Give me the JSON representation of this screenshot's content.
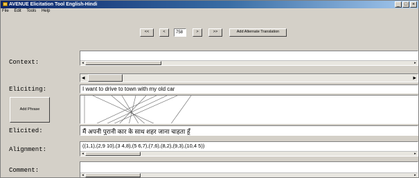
{
  "window": {
    "title": "AVENUE Elicitation Tool English-Hindi",
    "buttons": [
      "_",
      "□",
      "×"
    ]
  },
  "menu": [
    "File",
    "Edit",
    "Tools",
    "Help"
  ],
  "nav": {
    "first": "<<",
    "prev": "<",
    "current": "758",
    "next": ">",
    "last": ">>",
    "add_alternate": "Add Alternate Translation"
  },
  "labels": {
    "context": "Context:",
    "eliciting": "Eliciting:",
    "elicited": "Elicited:",
    "alignment": "Alignment:",
    "comment": "Comment:"
  },
  "eliciting_text": "I want to drive to town with my old car",
  "add_phrase": "Add Phrase",
  "elicited_text": "मैं अपनी पुरानी कार के साथ शहर जाना चाहता हूँ",
  "alignment_text": "((1,1),(2,9 10),(3 4,8),(5 6,7),(7,6),(8,2),(9,3),(10,4 5))",
  "icons": {
    "scroll_left": "◂",
    "scroll_right": "▸"
  }
}
